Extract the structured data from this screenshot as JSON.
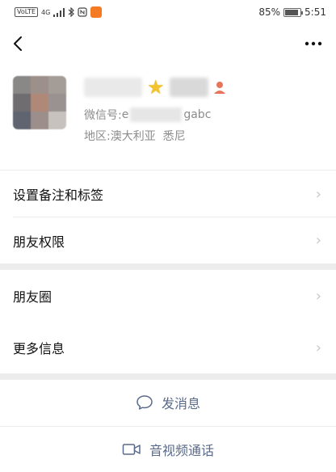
{
  "status_bar": {
    "left_tag": "VoLTE",
    "signal_label": "4G",
    "battery_percent": "85%",
    "time": "5:51"
  },
  "profile": {
    "wechat_id_label": "微信号: ",
    "wechat_id_prefix": "e",
    "wechat_id_suffix": "gabc",
    "region_label": "地区: ",
    "region_value": "澳大利亚  悉尼"
  },
  "menu": {
    "items": [
      {
        "label": "设置备注和标签"
      },
      {
        "label": "朋友权限"
      },
      {
        "label": "朋友圈"
      },
      {
        "label": "更多信息"
      }
    ]
  },
  "actions": {
    "message_label": "发消息",
    "call_label": "音视频通话"
  },
  "colors": {
    "accent_text": "#5a6a8a",
    "separator": "#ededed",
    "app_icon": "#f47a23"
  }
}
